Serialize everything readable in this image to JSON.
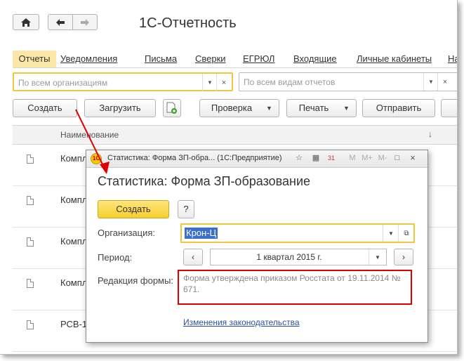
{
  "app": {
    "title": "1С-Отчетность",
    "home_icon": "home-icon",
    "back_icon": "arrow-left-icon",
    "forward_icon": "arrow-right-icon"
  },
  "tabs": [
    {
      "label": "Отчеты",
      "active": true
    },
    {
      "label": "Уведомления"
    },
    {
      "label": "Письма"
    },
    {
      "label": "Сверки"
    },
    {
      "label": "ЕГРЮЛ"
    },
    {
      "label": "Входящие"
    },
    {
      "label": "Личные кабинеты"
    },
    {
      "label": "На"
    }
  ],
  "filters": {
    "org_placeholder": "По всем организациям",
    "report_placeholder": "По всем видам отчетов"
  },
  "toolbar": {
    "create": "Создать",
    "load": "Загрузить",
    "check": "Проверка",
    "print": "Печать",
    "send": "Отправить"
  },
  "grid": {
    "column": "Наименование",
    "sort_mark": "↓",
    "rows": [
      "Компл",
      "Компл",
      "Компл",
      "Компл",
      "РСВ-1"
    ]
  },
  "dialog": {
    "window_title": "Статистика: Форма ЗП-обра...   (1С:Предприятие)",
    "heading": "Статистика: Форма ЗП-образование",
    "create": "Создать",
    "help": "?",
    "org_label": "Организация:",
    "org_value": "Крон-Ц",
    "period_label": "Период:",
    "period_value": "1 квартал 2015 г.",
    "edition_label": "Редакция формы:",
    "edition_text": "Форма утверждена приказом Росстата от 19.11.2014 № 671.",
    "law_link": "Изменения законодательства",
    "tb_m": "M",
    "tb_mplus": "M+",
    "tb_mminus": "M-",
    "tb_calendar_num": "31"
  },
  "colors": {
    "accent_yellow": "#f5cf2e",
    "highlight_red": "#e00000",
    "selection_blue": "#3b6fc9"
  }
}
